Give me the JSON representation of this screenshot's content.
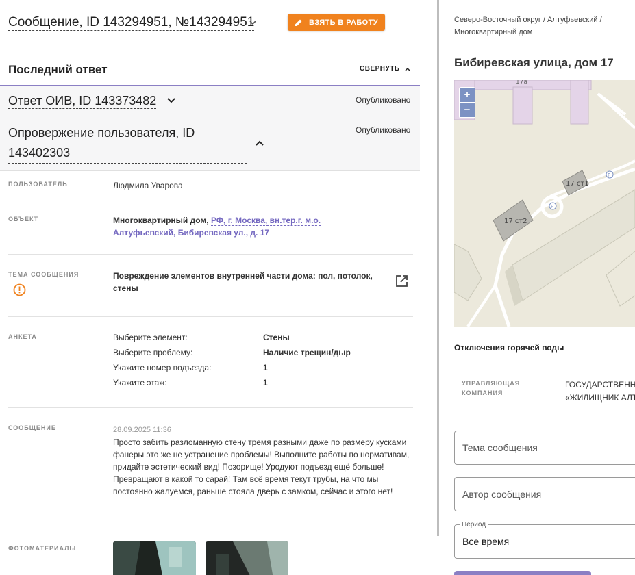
{
  "header": {
    "title": "Сообщение, ID 143294951, №143294951",
    "take_button": "ВЗЯТЬ В РАБОТУ"
  },
  "last_answer": {
    "heading": "Последний ответ",
    "collapse_label": "СВЕРНУТЬ",
    "answers": [
      {
        "title": "Ответ ОИВ, ID 143373482",
        "status": "Опубликовано"
      },
      {
        "title": "Опровержение пользователя, ID 143402303",
        "status": "Опубликовано"
      }
    ]
  },
  "fields": {
    "user_label": "ПОЛЬЗОВАТЕЛЬ",
    "user_value": "Людмила Уварова",
    "object_label": "ОБЪЕКТ",
    "object_type": "Многоквартирный дом,",
    "object_link_1": "РФ, г. Москва, вн.тер.г. м.о.",
    "object_link_2": "Алтуфьевский, Бибиревская ул., д. 17",
    "topic_label": "ТЕМА СООБЩЕНИЯ",
    "topic_value": "Повреждение элементов внутренней части дома: пол, потолок, стены",
    "survey_label": "АНКЕТА",
    "survey": [
      {
        "q": "Выберите элемент:",
        "a": "Стены"
      },
      {
        "q": "Выберите проблему:",
        "a": "Наличие трещин/дыр"
      },
      {
        "q": "Укажите номер подъезда:",
        "a": "1"
      },
      {
        "q": "Укажите этаж:",
        "a": "1"
      }
    ],
    "message_label": "СООБЩЕНИЕ",
    "message_date": "28.09.2025 11:36",
    "message_text": "Просто забить разломанную стену тремя разными даже по размеру кусками фанеры это же не устранение проблемы! Выполните работы по нормативам, придайте эстетический вид! Позорище! Уродуют подъезд ещё больше! Превращают в какой то сарай! Там всё время текут трубы, на что мы постоянно жалуемся, раньше стояла дверь с замком, сейчас и этого нет!",
    "photos_label": "ФОТОМАТЕРИАЛЫ"
  },
  "right": {
    "breadcrumb": "Северо-Восточный округ / Алтуфьевский / Многоквартирный дом",
    "address": "Бибиревская улица, дом 17",
    "map": {
      "zoom_in": "+",
      "zoom_out": "−",
      "labels": [
        "17а",
        "17 ст1",
        "17 ст2",
        "P",
        "P"
      ]
    },
    "hot_water": "Отключения горячей воды",
    "uk_label": "УПРАВЛЯЮЩАЯ КОМПАНИЯ",
    "uk_value_1": "ГОСУДАРСТВЕНН",
    "uk_value_2": "«ЖИЛИЩНИК АЛТ",
    "topic_placeholder": "Тема сообщения",
    "author_placeholder": "Автор сообщения",
    "period_label": "Период",
    "period_value": "Все время"
  },
  "colors": {
    "accent_orange": "#f0821e",
    "accent_purple": "#8b7fc4",
    "link_purple": "#7468c0",
    "warning": "#f0821e"
  }
}
